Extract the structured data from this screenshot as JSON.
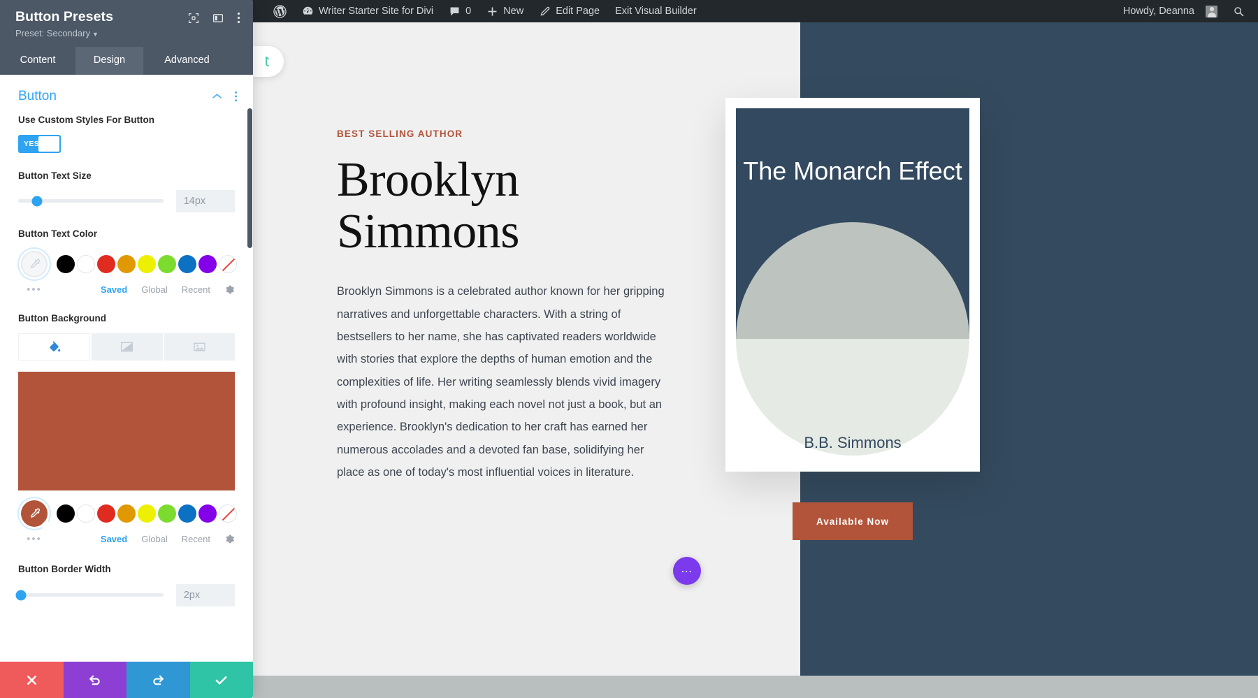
{
  "adminbar": {
    "items": [
      {
        "name": "wordpress-logo",
        "label": ""
      },
      {
        "name": "site-name",
        "label": "Writer Starter Site for Divi"
      },
      {
        "name": "comments",
        "label": "0"
      },
      {
        "name": "new-content",
        "label": "New"
      },
      {
        "name": "edit-page",
        "label": "Edit Page"
      },
      {
        "name": "exit-visual-builder",
        "label": "Exit Visual Builder"
      }
    ],
    "howdy": "Howdy, Deanna",
    "search_label": "Search"
  },
  "panel": {
    "title": "Button Presets",
    "preset_label": "Preset: Secondary",
    "tabs": [
      {
        "label": "Content",
        "active": false
      },
      {
        "label": "Design",
        "active": true
      },
      {
        "label": "Advanced",
        "active": false
      }
    ],
    "section": {
      "title": "Button"
    },
    "fields": {
      "custom_styles": {
        "label": "Use Custom Styles For Button",
        "toggle_value": "YES"
      },
      "text_size": {
        "label": "Button Text Size",
        "value": "14px",
        "slider_percent": 13
      },
      "text_color": {
        "label": "Button Text Color",
        "selected": "",
        "swatches": [
          "#000000",
          "#ffffff",
          "#e02b20",
          "#e09900",
          "#edf000",
          "#7cdb2f",
          "#0c71c3",
          "#8300e9",
          "none"
        ],
        "links": [
          {
            "label": "Saved",
            "active": true
          },
          {
            "label": "Global",
            "active": false
          },
          {
            "label": "Recent",
            "active": false
          }
        ]
      },
      "background": {
        "label": "Button Background",
        "types": [
          {
            "name": "color",
            "active": true
          },
          {
            "name": "gradient",
            "active": false
          },
          {
            "name": "image",
            "active": false
          }
        ],
        "color": "#b1543a",
        "swatches": [
          "#000000",
          "#ffffff",
          "#e02b20",
          "#e09900",
          "#edf000",
          "#7cdb2f",
          "#0c71c3",
          "#8300e9",
          "none"
        ],
        "links": [
          {
            "label": "Saved",
            "active": true
          },
          {
            "label": "Global",
            "active": false
          },
          {
            "label": "Recent",
            "active": false
          }
        ]
      },
      "border_width": {
        "label": "Button Border Width",
        "value": "2px",
        "slider_percent": 2
      }
    },
    "footer": [
      {
        "name": "cancel",
        "glyph": "✖"
      },
      {
        "name": "undo",
        "glyph": "↺"
      },
      {
        "name": "redo",
        "glyph": "↻"
      },
      {
        "name": "save",
        "glyph": "✔"
      }
    ]
  },
  "page": {
    "eyebrow": "Best Selling Author",
    "headline": "Brooklyn Simmons",
    "body": "Brooklyn Simmons is a celebrated author known for her gripping narratives and unforgettable characters. With a string of bestsellers to her name, she has captivated readers worldwide with stories that explore the depths of human emotion and the complexities of life. Her writing seamlessly blends vivid imagery with profound insight, making each novel not just a book, but an experience. Brooklyn's dedication to her craft has earned her numerous accolades and a devoted fan base, solidifying her place as one of today's most influential voices in literature.",
    "book": {
      "title": "The Monarch Effect",
      "author": "B.B. Simmons"
    },
    "cta_label": "Available Now"
  },
  "colors": {
    "accent_blue": "#2ea3f2",
    "brand_rust": "#b1543a",
    "panel_header": "#4c5866",
    "book_navy": "#32495f",
    "canvas_right": "#344a5e"
  }
}
